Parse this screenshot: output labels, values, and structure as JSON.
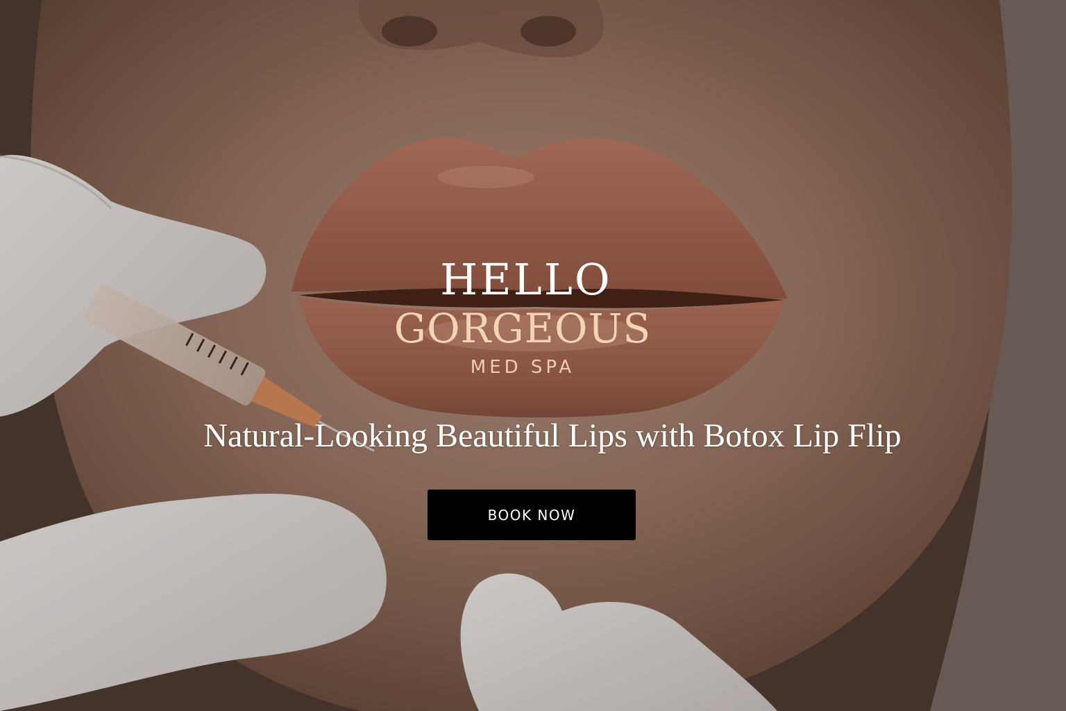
{
  "logo": {
    "line1": "HELLO",
    "line2": "GORGEOUS",
    "line3": "MED SPA"
  },
  "hero": {
    "tagline": "Natural-Looking Beautiful Lips with Botox Lip Flip"
  },
  "cta": {
    "label": "BOOK NOW"
  },
  "colors": {
    "gold_accent": "#f3d5b1",
    "button_bg": "#000000",
    "button_text": "#ffffff"
  }
}
